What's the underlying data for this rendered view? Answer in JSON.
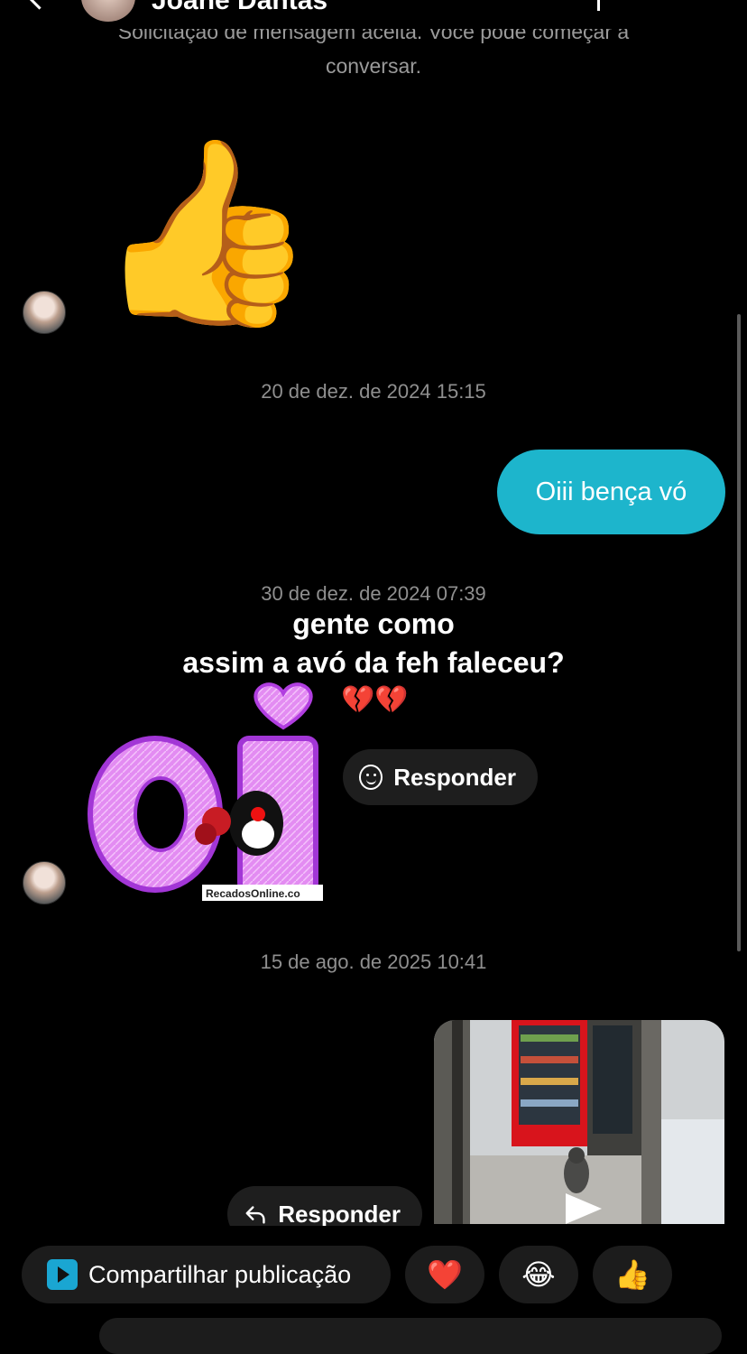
{
  "header": {
    "contact_name": "Joane Dantas"
  },
  "notice": {
    "line1": "Solicitação de mensagem aceita. Você pode começar a",
    "line2": "conversar."
  },
  "messages": {
    "thumbs_sticker": "👍",
    "timestamp_1": "20 de dez. de 2024 15:15",
    "outgoing_1": "Oiii bença vó",
    "timestamp_2": "30 de dez. de 2024 07:39",
    "overlay_line1": "gente como",
    "overlay_line2": "assim a avó da feh faleceu?",
    "overlay_emoji": "💔💔",
    "sticker_text": "oi",
    "sticker_watermark": "RecadosOnline.co",
    "respond_label": "Responder",
    "timestamp_3": "15 de ago. de 2025 10:41",
    "reply_label": "Responder"
  },
  "bottom": {
    "share_label": "Compartilhar publicação",
    "emoji_heart": "❤️",
    "emoji_laugh": "😂",
    "emoji_thumbs": "👍"
  }
}
